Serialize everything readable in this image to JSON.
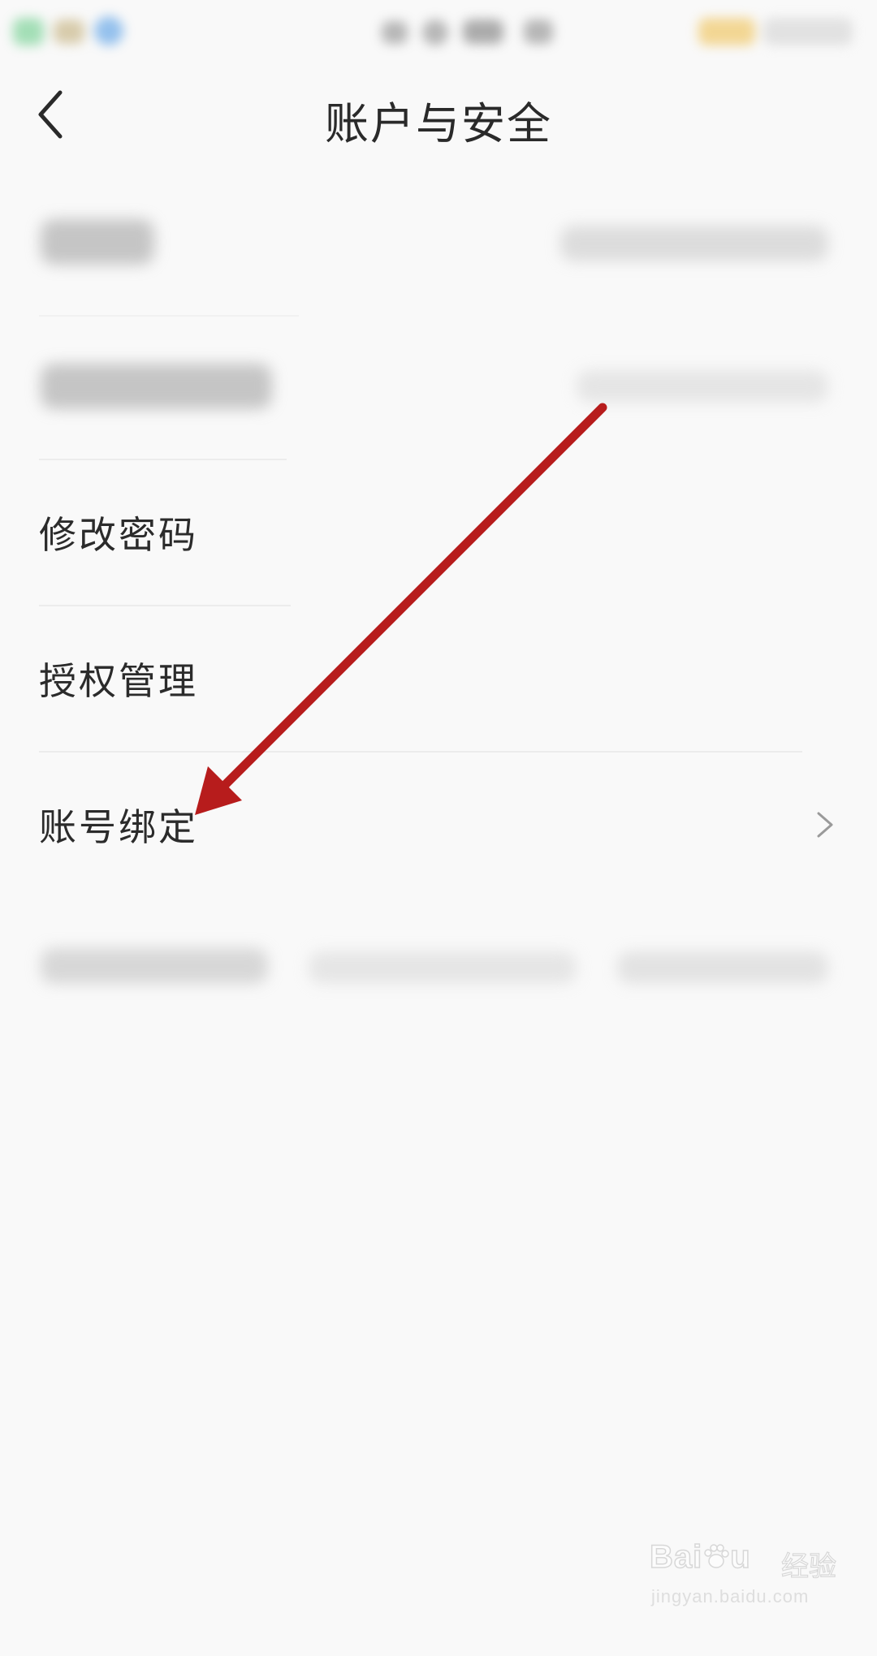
{
  "header": {
    "title": "账户与安全",
    "back_icon": "chevron-left-icon"
  },
  "menu": {
    "items": [
      {
        "label": "修改密码"
      },
      {
        "label": "授权管理"
      },
      {
        "label": "账号绑定",
        "has_chevron": true
      }
    ]
  },
  "annotation": {
    "arrow_color": "#b71c1c"
  },
  "watermark": {
    "brand": "Bai",
    "brand_suffix": "u",
    "cn": "经验",
    "url": "jingyan.baidu.com"
  },
  "colors": {
    "background": "#f9f9f9",
    "text": "#2b2b2b",
    "divider": "#ececec",
    "chevron": "#999999"
  }
}
